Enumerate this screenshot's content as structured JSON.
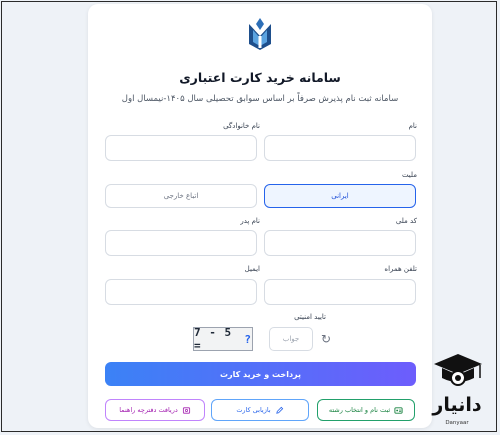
{
  "page": {
    "title": "سامانه خرید کارت اعتباری",
    "subtitle": "سامانه ثبت نام پذیرش صرفاً بر اساس سوابق تحصیلی سال ۱۴۰۵-نیمسال اول"
  },
  "form": {
    "first_name_label": "نام",
    "last_name_label": "نام خانوادگی",
    "nationality_label": "ملیت",
    "nationality_options": [
      "ایرانی",
      "اتباع خارجی"
    ],
    "nationality_selected": "ایرانی",
    "national_code_label": "کد ملی",
    "father_name_label": "نام پدر",
    "mobile_label": "تلفن همراه",
    "email_label": "ایمیل",
    "captcha_label": "تایید امنیتی",
    "captcha_text": "7 - 5 =",
    "captcha_question": "?",
    "captcha_placeholder": "جواب"
  },
  "buttons": {
    "pay": "پرداخت و خرید کارت",
    "register": "ثبت نام و انتخاب رشته",
    "recovery": "بازیابی کارت",
    "booklet": "دریافت دفترچه راهنما"
  },
  "icons": {
    "register": "id-card-icon",
    "recovery": "pencil-icon",
    "booklet": "book-icon",
    "refresh": "refresh-icon",
    "logo": "university-logo"
  },
  "watermark": {
    "name": "دانیار",
    "latin": "Danyaar"
  },
  "colors": {
    "accent": "#2563eb",
    "pay_gradient_start": "#3b82f6",
    "pay_gradient_end": "#6d5dfc",
    "green": "#15803d",
    "pink": "#a21caf"
  }
}
